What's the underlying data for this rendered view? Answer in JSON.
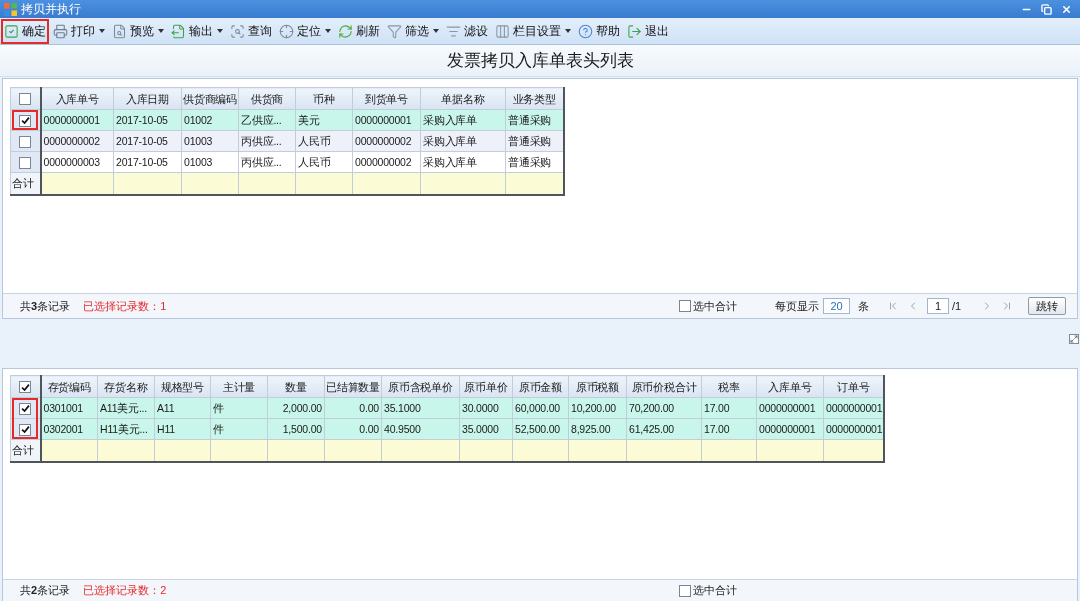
{
  "window": {
    "title": "拷贝并执行"
  },
  "toolbar": [
    {
      "label": "确定",
      "dropdown": false,
      "highlighted": true
    },
    {
      "label": "打印",
      "dropdown": true,
      "highlighted": false
    },
    {
      "label": "预览",
      "dropdown": true,
      "highlighted": false
    },
    {
      "label": "输出",
      "dropdown": true,
      "highlighted": false
    },
    {
      "label": "查询",
      "dropdown": false,
      "highlighted": false
    },
    {
      "label": "定位",
      "dropdown": true,
      "highlighted": false
    },
    {
      "label": "刷新",
      "dropdown": false,
      "highlighted": false
    },
    {
      "label": "筛选",
      "dropdown": true,
      "highlighted": false
    },
    {
      "label": "滤设",
      "dropdown": false,
      "highlighted": false
    },
    {
      "label": "栏目设置",
      "dropdown": true,
      "highlighted": false
    },
    {
      "label": "帮助",
      "dropdown": false,
      "highlighted": false
    },
    {
      "label": "退出",
      "dropdown": false,
      "highlighted": false
    }
  ],
  "heading": "发票拷贝入库单表头列表",
  "header_table": {
    "select_all": false,
    "columns": [
      {
        "label": "入库单号",
        "kind": "text"
      },
      {
        "label": "入库日期",
        "kind": "text"
      },
      {
        "label": "供货商编码",
        "kind": "text"
      },
      {
        "label": "供货商",
        "kind": "text"
      },
      {
        "label": "币种",
        "kind": "text"
      },
      {
        "label": "到货单号",
        "kind": "text"
      },
      {
        "label": "单据名称",
        "kind": "text"
      },
      {
        "label": "业务类型",
        "kind": "text"
      }
    ],
    "rows": [
      {
        "checked": true,
        "highlighted": true,
        "cells": [
          "0000000001",
          "2017-10-05",
          "01002",
          "乙供应...",
          "美元",
          "0000000001",
          "采购入库单",
          "普通采购"
        ]
      },
      {
        "checked": false,
        "highlighted": false,
        "cells": [
          "0000000002",
          "2017-10-05",
          "01003",
          "丙供应...",
          "人民币",
          "0000000002",
          "采购入库单",
          "普通采购"
        ]
      },
      {
        "checked": false,
        "highlighted": false,
        "cells": [
          "0000000003",
          "2017-10-05",
          "01003",
          "丙供应...",
          "人民币",
          "0000000002",
          "采购入库单",
          "普通采购"
        ]
      }
    ],
    "total_label": "合计"
  },
  "header_status": {
    "count_text": "共**3**条记录",
    "selected_text": "已选择记录数：1",
    "sum_toggle": {
      "label": "选中合计",
      "checked": false
    },
    "pager": {
      "page_size_label": "每页显示",
      "page_size": "20",
      "page_size_unit": "条",
      "page": "1",
      "page_total": "/1",
      "jump_button": "跳转"
    }
  },
  "detail_table": {
    "select_all": true,
    "columns": [
      {
        "label": "存货编码",
        "kind": "text"
      },
      {
        "label": "存货名称",
        "kind": "text"
      },
      {
        "label": "规格型号",
        "kind": "text"
      },
      {
        "label": "主计量",
        "kind": "text"
      },
      {
        "label": "数量",
        "kind": "number"
      },
      {
        "label": "已结算数量",
        "kind": "number"
      },
      {
        "label": "原币含税单价",
        "kind": "text"
      },
      {
        "label": "原币单价",
        "kind": "text"
      },
      {
        "label": "原币金额",
        "kind": "text"
      },
      {
        "label": "原币税额",
        "kind": "text"
      },
      {
        "label": "原币价税合计",
        "kind": "text"
      },
      {
        "label": "税率",
        "kind": "text"
      },
      {
        "label": "入库单号",
        "kind": "text"
      },
      {
        "label": "订单号",
        "kind": "text"
      }
    ],
    "rows": [
      {
        "checked": true,
        "highlighted": true,
        "cells": [
          "0301001",
          "A11美元...",
          "A11",
          "件",
          "2,000.00",
          "0.00",
          "35.1000",
          "30.0000",
          "60,000.00",
          "10,200.00",
          "70,200.00",
          "17.00",
          "0000000001",
          "0000000001"
        ]
      },
      {
        "checked": true,
        "highlighted": true,
        "cells": [
          "0302001",
          "H11美元...",
          "H11",
          "件",
          "1,500.00",
          "0.00",
          "40.9500",
          "35.0000",
          "52,500.00",
          "8,925.00",
          "61,425.00",
          "17.00",
          "0000000001",
          "0000000001"
        ]
      }
    ],
    "total_label": "合计"
  },
  "detail_status": {
    "count_text": "共**2**条记录",
    "selected_text": "已选择记录数：2",
    "sum_toggle": {
      "label": "选中合计",
      "checked": false
    }
  }
}
